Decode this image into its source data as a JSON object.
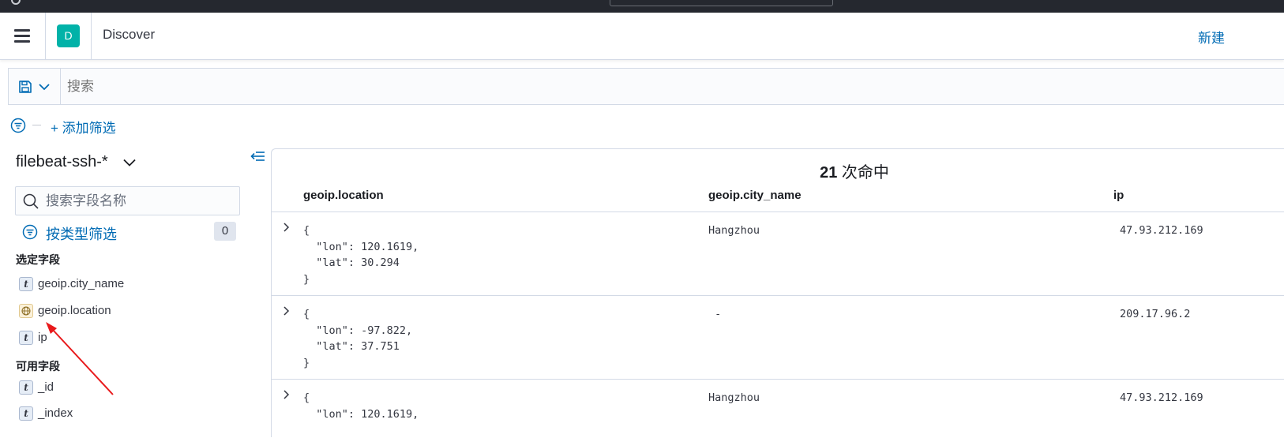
{
  "header": {
    "space_initial": "D",
    "app_title": "Discover",
    "new_label": "新建"
  },
  "query_bar": {
    "placeholder": "搜索"
  },
  "filters": {
    "add_filter_label": "+ 添加筛选"
  },
  "sidebar": {
    "index_pattern": "filebeat-ssh-*",
    "field_search_placeholder": "搜索字段名称",
    "filter_by_type_label": "按类型筛选",
    "filter_count": "0",
    "selected_title": "选定字段",
    "selected_fields": [
      {
        "name": "geoip.city_name",
        "type_icon": "t"
      },
      {
        "name": "geoip.location",
        "type_icon": "globe-icon"
      },
      {
        "name": "ip",
        "type_icon": "t"
      }
    ],
    "available_title": "可用字段",
    "available_fields": [
      {
        "name": "_id",
        "type_icon": "t"
      },
      {
        "name": "_index",
        "type_icon": "t"
      }
    ]
  },
  "results": {
    "hit_count": "21",
    "hit_suffix": " 次命中",
    "columns": [
      "geoip.location",
      "geoip.city_name",
      "ip"
    ],
    "rows": [
      {
        "location": "{\n  \"lon\": 120.1619,\n  \"lat\": 30.294\n}",
        "city": "Hangzhou",
        "ip": "47.93.212.169"
      },
      {
        "location": "{\n  \"lon\": -97.822,\n  \"lat\": 37.751\n}",
        "city": " -",
        "ip": "209.17.96.2"
      },
      {
        "location": "{\n  \"lon\": 120.1619,",
        "city": "Hangzhou",
        "ip": "47.93.212.169"
      }
    ]
  },
  "colors": {
    "accent": "#006bb4",
    "space_avatar": "#01b2a8",
    "annotation_arrow": "#e8191b"
  }
}
